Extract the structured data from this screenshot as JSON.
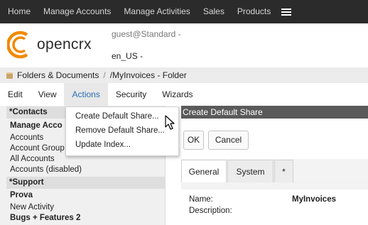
{
  "topnav": {
    "items": [
      "Home",
      "Manage Accounts",
      "Manage Activities",
      "Sales",
      "Products"
    ],
    "menu_icon": "hamburger-icon"
  },
  "header": {
    "logo_text": "opencrx",
    "user": "guest@Standard -",
    "locale": "en_US -"
  },
  "breadcrumb": {
    "icon": "folder-icon",
    "items": [
      "Folders & Documents",
      "/MyInvoices - Folder"
    ]
  },
  "menubar": {
    "items": [
      "Edit",
      "View",
      "Actions",
      "Security",
      "Wizards"
    ],
    "active": "Actions"
  },
  "dropdown": {
    "items": [
      "Create Default Share...",
      "Remove Default Share...",
      "Update Index..."
    ]
  },
  "sidebar": {
    "contacts_header": "*Contacts",
    "manage_accounts": "Manage Acco",
    "accounts": "Accounts",
    "account_groups": "Account Group",
    "all_accounts": "All Accounts",
    "accounts_disabled": "Accounts (disabled)",
    "support_header": "*Support",
    "prova": "Prova",
    "new_activity": "New Activity",
    "bugs_features": "Bugs + Features 2"
  },
  "dialog": {
    "title": "Create Default Share",
    "ok_label": "OK",
    "cancel_label": "Cancel",
    "tabs": [
      "General",
      "System",
      "*"
    ],
    "name_label": "Name:",
    "name_value": "MyInvoices",
    "description_label": "Description:"
  },
  "colors": {
    "topnav_bg": "#2b2b2b",
    "accent": "#2a6fb3",
    "logo_orange": "#f08a00",
    "dialog_title_bg": "#5a5a5a"
  }
}
